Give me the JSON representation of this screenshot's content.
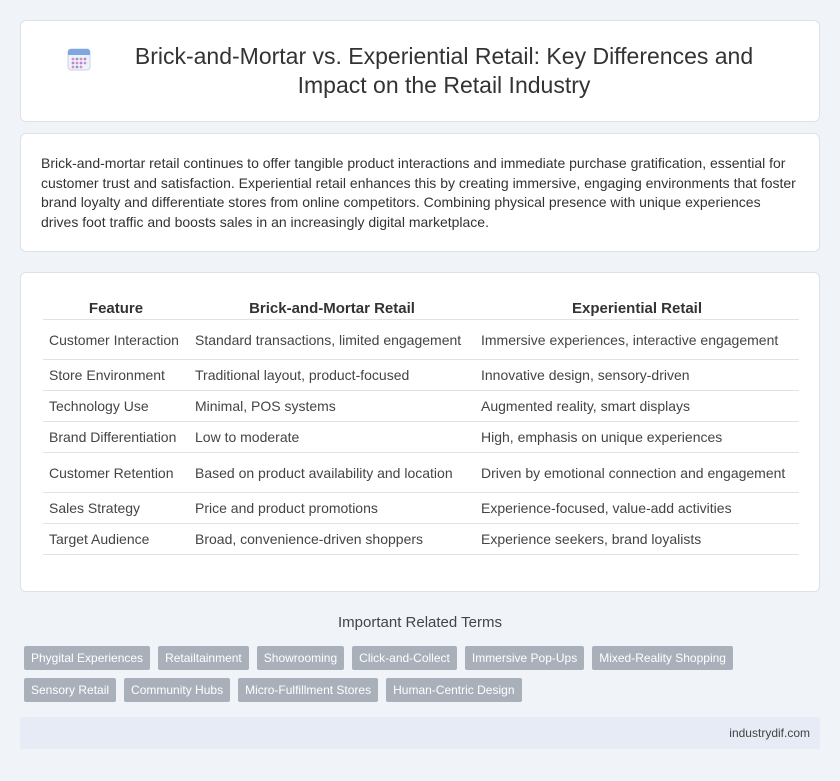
{
  "header": {
    "icon": "calendar-icon",
    "title": "Brick-and-Mortar vs. Experiential Retail: Key Differences and Impact on the Retail Industry"
  },
  "intro": {
    "text": "Brick-and-mortar retail continues to offer tangible product interactions and immediate purchase gratification, essential for customer trust and satisfaction. Experiential retail enhances this by creating immersive, engaging environments that foster brand loyalty and differentiate stores from online competitors. Combining physical presence with unique experiences drives foot traffic and boosts sales in an increasingly digital marketplace."
  },
  "table": {
    "headers": [
      "Feature",
      "Brick-and-Mortar Retail",
      "Experiential Retail"
    ],
    "rows": [
      [
        "Customer Interaction",
        "Standard transactions, limited engagement",
        "Immersive experiences, interactive engagement"
      ],
      [
        "Store Environment",
        "Traditional layout, product-focused",
        "Innovative design, sensory-driven"
      ],
      [
        "Technology Use",
        "Minimal, POS systems",
        "Augmented reality, smart displays"
      ],
      [
        "Brand Differentiation",
        "Low to moderate",
        "High, emphasis on unique experiences"
      ],
      [
        "Customer Retention",
        "Based on product availability and location",
        "Driven by emotional connection and engagement"
      ],
      [
        "Sales Strategy",
        "Price and product promotions",
        "Experience-focused, value-add activities"
      ],
      [
        "Target Audience",
        "Broad, convenience-driven shoppers",
        "Experience seekers, brand loyalists"
      ]
    ]
  },
  "related": {
    "title": "Important Related Terms",
    "tags_row1": [
      "Phygital Experiences",
      "Retailtainment",
      "Showrooming",
      "Click-and-Collect",
      "Immersive Pop-Ups",
      "Mixed-Reality Shopping"
    ],
    "tags_row2": [
      "Sensory Retail",
      "Community Hubs",
      "Micro-Fulfillment Stores",
      "Human-Centric Design"
    ]
  },
  "footer": {
    "text": "industrydif.com"
  },
  "colors": {
    "background": "#f0f3f8",
    "tag": "#a9b0ba",
    "footer": "#e6ebf5",
    "icon_accent": "#7ea6e0"
  }
}
